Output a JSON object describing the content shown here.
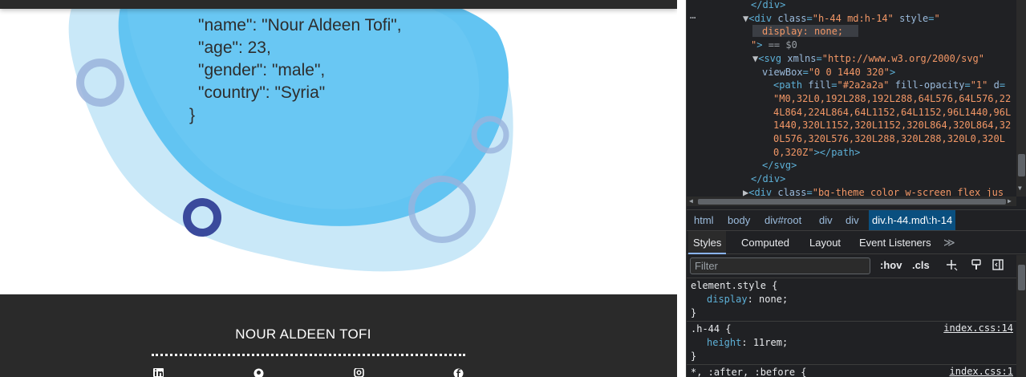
{
  "page": {
    "json_lines": [
      "{",
      "\"name\": \"Nour Aldeen Tofi\",",
      "\"age\": 23,",
      "\"gender\": \"male\",",
      "\"country\": \"Syria\"",
      "}"
    ],
    "footer": {
      "name": "NOUR ALDEEN TOFI",
      "social_icons": [
        "linkedin-icon",
        "github-icon",
        "instagram-icon",
        "facebook-icon"
      ]
    },
    "colors": {
      "blob_dark": "#62c4f2",
      "blob_light": "#c9e8f8",
      "ring_navy": "#3a4a9c",
      "ring_faded": "#9ab3dc",
      "footer_bg": "#2a2a2a"
    }
  },
  "devtools": {
    "elements": {
      "lines": [
        {
          "indent": 80,
          "parts": [
            [
              "tag",
              "</div>"
            ]
          ]
        },
        {
          "indent": 70,
          "parts": [
            [
              "dim",
              "▼"
            ],
            [
              "tag",
              "<div "
            ],
            [
              "attr",
              "class"
            ],
            [
              "tag",
              "="
            ],
            [
              "val",
              "\"h-44 md:h-14\""
            ],
            [
              "tag",
              " "
            ],
            [
              "attr",
              "style"
            ],
            [
              "tag",
              "="
            ],
            [
              "val",
              "\""
            ]
          ]
        },
        {
          "indent": 94,
          "parts": [
            [
              "val",
              "display: none;"
            ]
          ]
        },
        {
          "indent": 80,
          "parts": [
            [
              "val",
              "\""
            ],
            [
              "tag",
              ">"
            ],
            [
              "muted",
              " == $0"
            ]
          ]
        },
        {
          "indent": 82,
          "parts": [
            [
              "dim",
              "▼"
            ],
            [
              "tag",
              "<svg "
            ],
            [
              "attr",
              "xmlns"
            ],
            [
              "tag",
              "="
            ],
            [
              "val",
              "\"http://www.w3.org/2000/svg\""
            ]
          ]
        },
        {
          "indent": 94,
          "parts": [
            [
              "attr",
              "viewBox"
            ],
            [
              "tag",
              "="
            ],
            [
              "val",
              "\"0 0 1440 320\""
            ],
            [
              "tag",
              ">"
            ]
          ]
        },
        {
          "indent": 108,
          "parts": [
            [
              "tag",
              "<path "
            ],
            [
              "attr",
              "fill"
            ],
            [
              "tag",
              "="
            ],
            [
              "val",
              "\"#2a2a2a\""
            ],
            [
              "tag",
              " "
            ],
            [
              "attr",
              "fill-opacity"
            ],
            [
              "tag",
              "="
            ],
            [
              "val",
              "\"1\""
            ],
            [
              "tag",
              " "
            ],
            [
              "attr",
              "d"
            ],
            [
              "tag",
              "="
            ]
          ]
        },
        {
          "indent": 108,
          "parts": [
            [
              "val",
              "\"M0,32L0,192L288,192L288,64L576,64L576,22"
            ]
          ]
        },
        {
          "indent": 108,
          "parts": [
            [
              "val",
              "4L864,224L864,64L1152,64L1152,96L1440,96L"
            ]
          ]
        },
        {
          "indent": 108,
          "parts": [
            [
              "val",
              "1440,320L1152,320L1152,320L864,320L864,32"
            ]
          ]
        },
        {
          "indent": 108,
          "parts": [
            [
              "val",
              "0L576,320L576,320L288,320L288,320L0,320L"
            ]
          ]
        },
        {
          "indent": 108,
          "parts": [
            [
              "val",
              "0,320Z\""
            ],
            [
              "tag",
              "></path>"
            ]
          ]
        },
        {
          "indent": 94,
          "parts": [
            [
              "tag",
              "</svg>"
            ]
          ]
        },
        {
          "indent": 80,
          "parts": [
            [
              "tag",
              "</div>"
            ]
          ]
        },
        {
          "indent": 70,
          "parts": [
            [
              "dim",
              "▶"
            ],
            [
              "tag",
              "<div "
            ],
            [
              "attr",
              "class"
            ],
            [
              "tag",
              "="
            ],
            [
              "val",
              "\"bg-theme color w-screen flex jus"
            ]
          ]
        }
      ],
      "dots": "⋯"
    },
    "breadcrumb": [
      "html",
      "body",
      "div#root",
      "div",
      "div",
      "div.h-44.md\\:h-14"
    ],
    "tabs": [
      "Styles",
      "Computed",
      "Layout",
      "Event Listeners"
    ],
    "more_tabs": "≫",
    "filter_placeholder": "Filter",
    "hov_label": ":hov",
    "cls_label": ".cls",
    "styles": [
      {
        "selector": "element.style {",
        "prop": "display",
        "value": "none",
        "close": "}",
        "source": ""
      },
      {
        "selector": ".h-44 {",
        "prop": "height",
        "value": "11rem",
        "close": "}",
        "source": "index.css:14"
      },
      {
        "selector": "*, :after, :before {",
        "prop": "",
        "value": "",
        "close": "",
        "source": "index.css:1"
      }
    ]
  }
}
